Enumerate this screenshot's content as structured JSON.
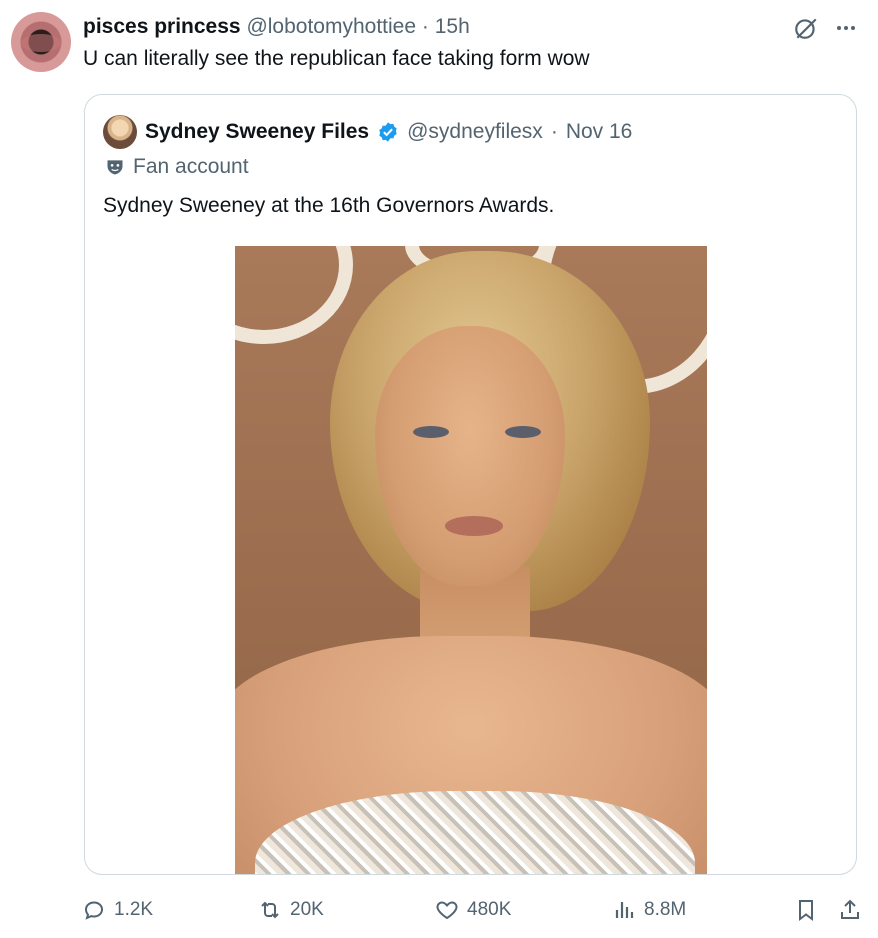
{
  "tweet": {
    "author_name": "pisces princess",
    "author_handle": "@lobotomyhottiee",
    "separator": "·",
    "time": "15h",
    "text": "U can literally see the republican face taking form wow"
  },
  "quoted_tweet": {
    "author_name": "Sydney Sweeney Files",
    "author_handle": "@sydneyfilesx",
    "separator": "·",
    "date": "Nov 16",
    "label": "Fan account",
    "text": "Sydney Sweeney at the 16th Governors Awards."
  },
  "actions": {
    "replies": "1.2K",
    "reposts": "20K",
    "likes": "480K",
    "views": "8.8M"
  },
  "icons": {
    "avatar": "profile-avatar",
    "more": "more-icon",
    "grok": "grok-icon",
    "verified": "verified-badge-icon",
    "fan": "mask-icon",
    "reply": "reply-icon",
    "repost": "repost-icon",
    "like": "heart-icon",
    "views": "views-icon",
    "bookmark": "bookmark-icon",
    "share": "share-icon"
  },
  "colors": {
    "text": "#0f1419",
    "secondary": "#536471",
    "verified": "#1d9bf0",
    "border": "#cfd9de"
  }
}
